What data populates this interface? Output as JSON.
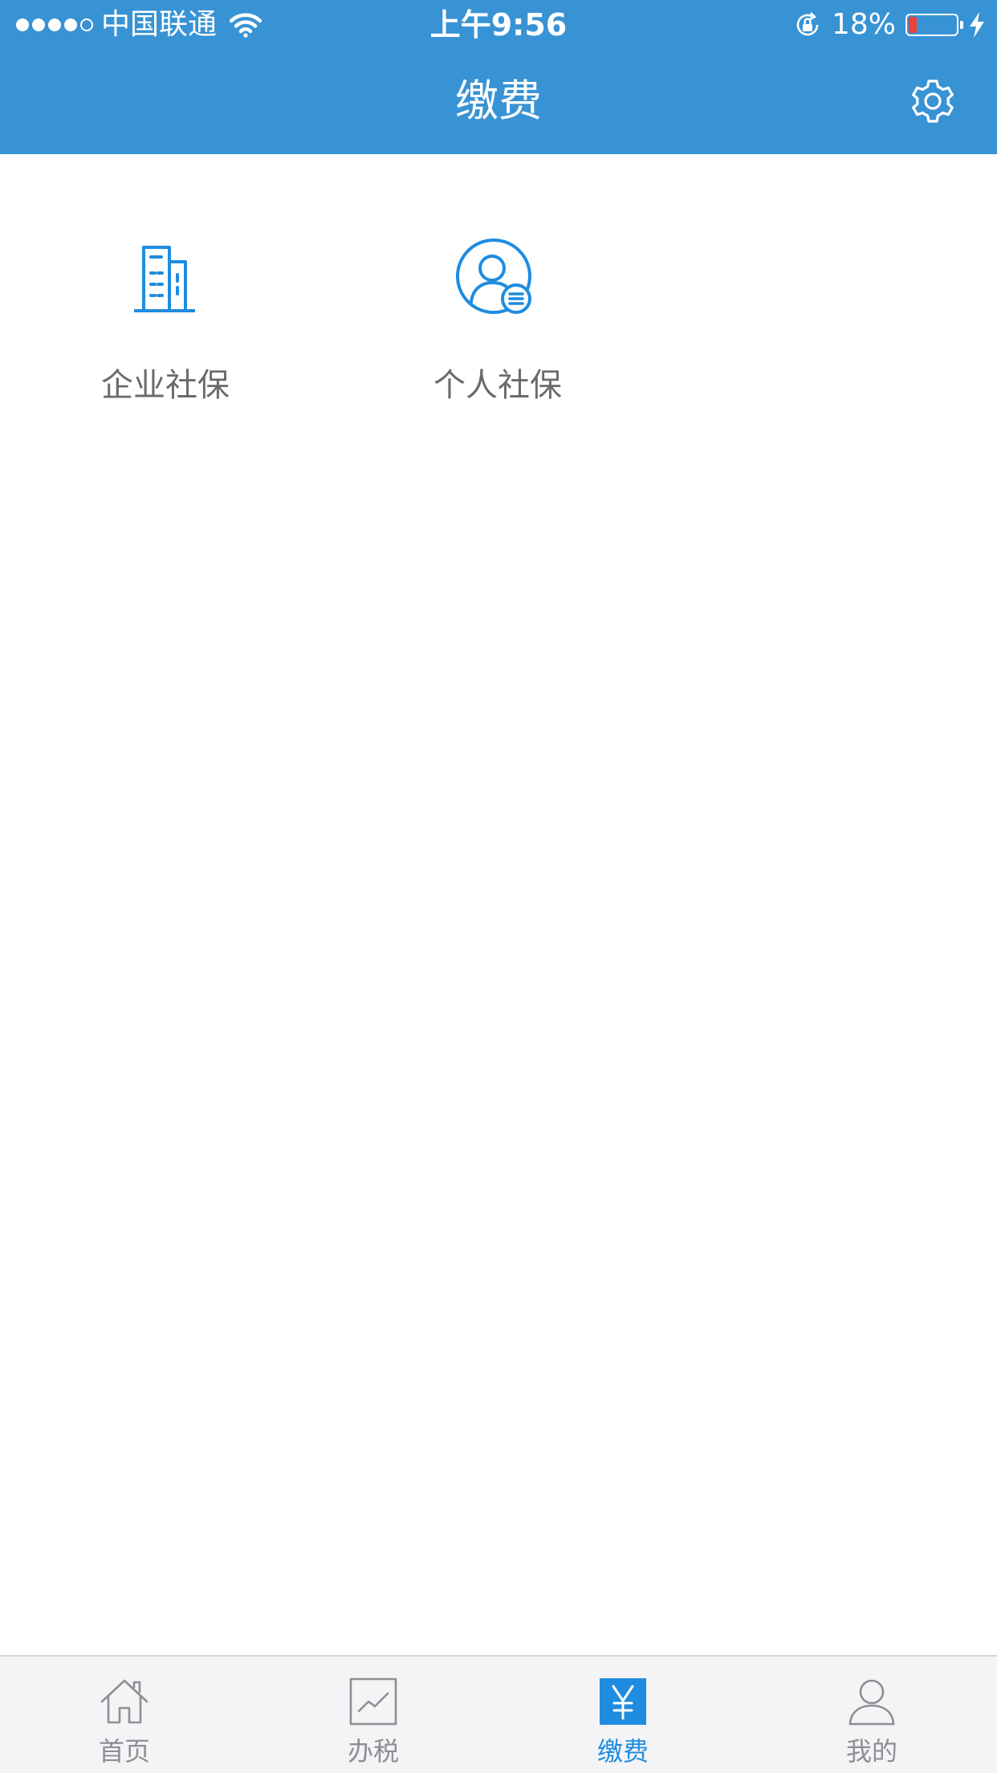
{
  "status_bar": {
    "carrier": "中国联通",
    "time": "上午9:56",
    "battery_percent": "18%",
    "battery_level": 0.18,
    "signal_bars_filled": 4,
    "signal_bars_total": 5
  },
  "nav": {
    "title": "缴费",
    "settings_icon": "gear-icon"
  },
  "grid": {
    "items": [
      {
        "label": "企业社保",
        "icon": "building-icon"
      },
      {
        "label": "个人社保",
        "icon": "person-badge-icon"
      }
    ]
  },
  "tabbar": {
    "items": [
      {
        "label": "首页",
        "icon": "home-icon",
        "active": false
      },
      {
        "label": "办税",
        "icon": "chart-icon",
        "active": false
      },
      {
        "label": "缴费",
        "icon": "yuan-icon",
        "active": true
      },
      {
        "label": "我的",
        "icon": "user-icon",
        "active": false
      }
    ]
  },
  "colors": {
    "header_bg": "#3893d4",
    "accent": "#1f8ce0",
    "tab_inactive": "#8e8e93",
    "battery_low": "#e8423a"
  }
}
